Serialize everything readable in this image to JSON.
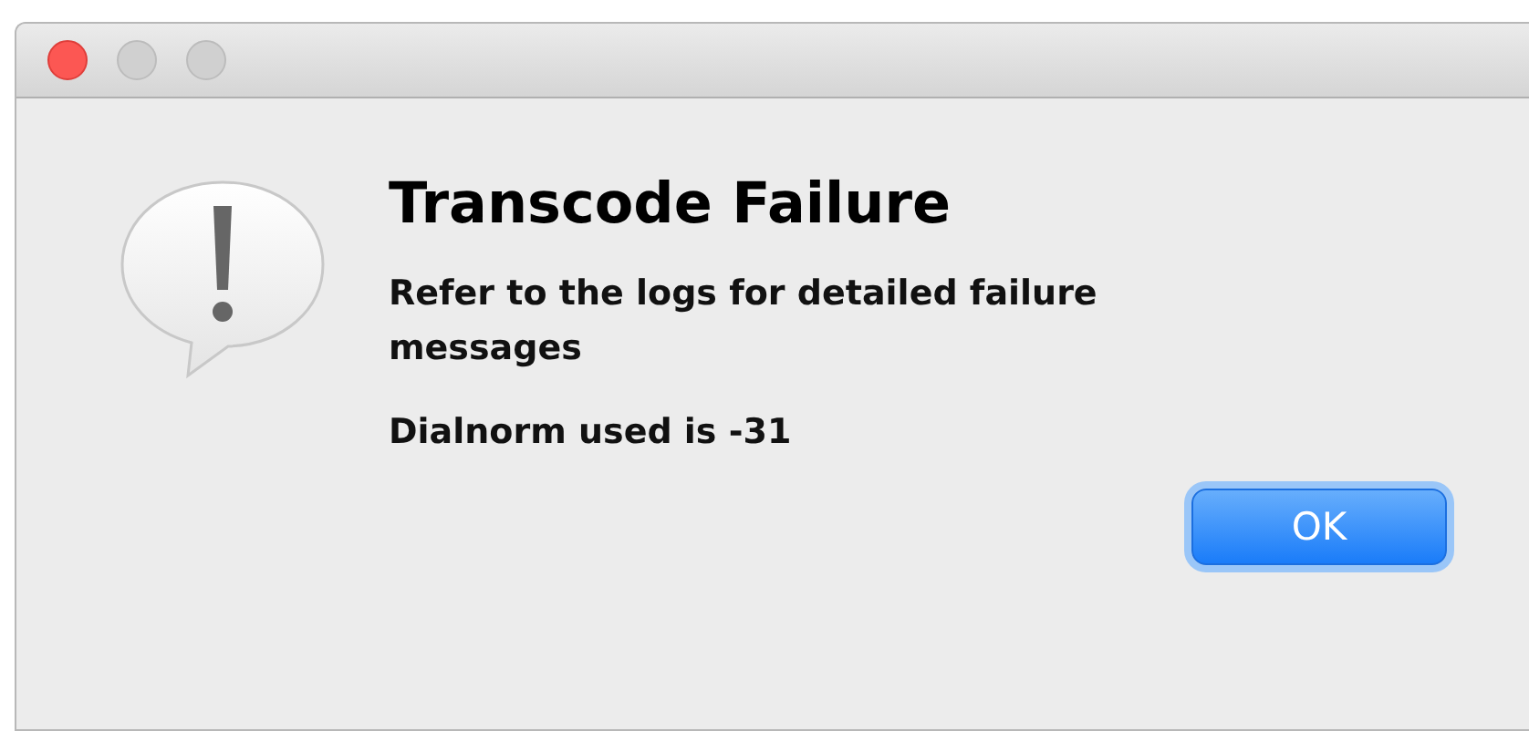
{
  "window": {
    "traffic_lights": [
      {
        "kind": "close",
        "active": true
      },
      {
        "kind": "minimize",
        "active": false
      },
      {
        "kind": "zoom",
        "active": false
      }
    ]
  },
  "alert": {
    "title": "Transcode Failure",
    "messages": [
      "Refer to the logs for detailed failure messages",
      "Dialnorm used is -31"
    ]
  },
  "buttons": [
    {
      "label": "OK",
      "default": true
    }
  ]
}
